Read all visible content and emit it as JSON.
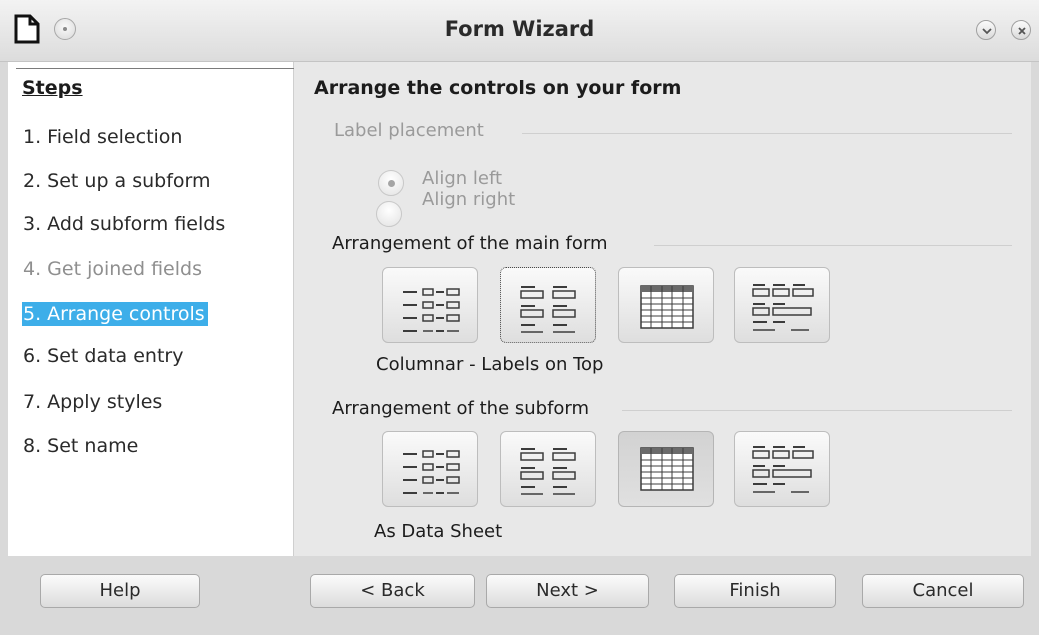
{
  "window": {
    "title": "Form Wizard"
  },
  "steps": {
    "heading": "Steps",
    "items": [
      {
        "label": "1. Field selection",
        "state": "normal"
      },
      {
        "label": "2. Set up a subform",
        "state": "normal"
      },
      {
        "label": "3. Add subform fields",
        "state": "normal"
      },
      {
        "label": "4. Get joined fields",
        "state": "disabled"
      },
      {
        "label": "5. Arrange controls",
        "state": "active"
      },
      {
        "label": "6. Set data entry",
        "state": "normal"
      },
      {
        "label": "7. Apply styles",
        "state": "normal"
      },
      {
        "label": "8. Set name",
        "state": "normal"
      }
    ]
  },
  "page": {
    "heading": "Arrange the controls on your form",
    "label_placement": {
      "title": "Label placement",
      "options": [
        "Align left",
        "Align right"
      ],
      "selected": "Align left"
    },
    "main_form": {
      "title": "Arrangement of the main form",
      "selected_caption": "Columnar - Labels on Top",
      "buttons": [
        "columnar-labels-left",
        "columnar-labels-on-top",
        "as-data-sheet",
        "in-blocks-labels-above"
      ]
    },
    "subform": {
      "title": "Arrangement of the subform",
      "selected_caption": "As Data Sheet",
      "buttons": [
        "columnar-labels-left",
        "columnar-labels-on-top",
        "as-data-sheet",
        "in-blocks-labels-above"
      ]
    }
  },
  "footer": {
    "help": "Help",
    "back": "< Back",
    "next": "Next >",
    "finish": "Finish",
    "cancel": "Cancel"
  },
  "colors": {
    "accent": "#3daee9"
  }
}
